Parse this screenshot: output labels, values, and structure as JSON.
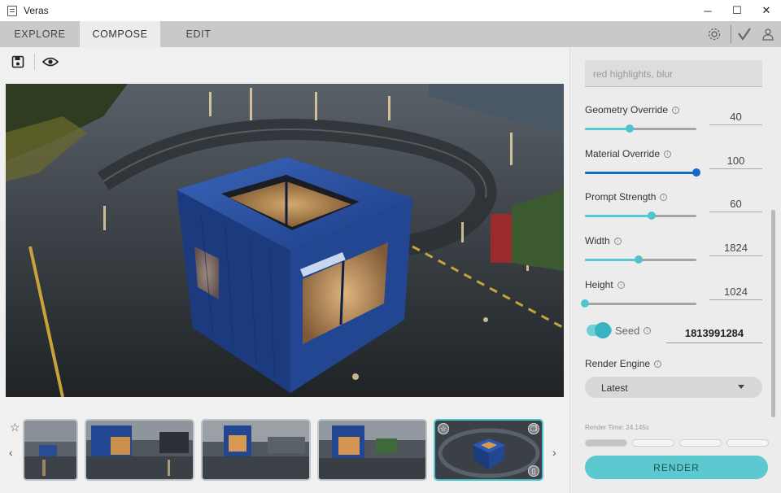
{
  "window": {
    "title": "Veras",
    "controls": [
      "─",
      "☐",
      "✕"
    ]
  },
  "tabs": [
    {
      "label": "EXPLORE",
      "active": false
    },
    {
      "label": "COMPOSE",
      "active": true
    },
    {
      "label": "EDIT",
      "active": false
    }
  ],
  "toolbar_icons": [
    "settings-icon",
    "check-icon",
    "user-icon"
  ],
  "tools": [
    "save-icon",
    "eye-icon"
  ],
  "panel": {
    "negative_prompt": "red highlights, blur",
    "params": [
      {
        "label": "Geometry Override",
        "value": "40",
        "fraction": 0.4
      },
      {
        "label": "Material Override",
        "value": "100",
        "fraction": 1.0
      },
      {
        "label": "Prompt Strength",
        "value": "60",
        "fraction": 0.6
      },
      {
        "label": "Width",
        "value": "1824",
        "fraction": 0.48
      },
      {
        "label": "Height",
        "value": "1024",
        "fraction": 0.0
      }
    ],
    "seed": {
      "label": "Seed",
      "value": "1813991284",
      "enabled": true
    },
    "render_engine": {
      "label": "Render Engine",
      "selected": "Latest"
    },
    "render_time": "Render Time: 24.145s",
    "progress_done": 1,
    "progress_total": 4,
    "render_button": "RENDER"
  },
  "filmstrip": {
    "count": 5,
    "selected_index": 4
  },
  "colors": {
    "accent": "#5cc8d0",
    "slider_active": "#1569c7",
    "tab_bar": "#c9c9c9",
    "container_blue": "#1e3f8a"
  }
}
